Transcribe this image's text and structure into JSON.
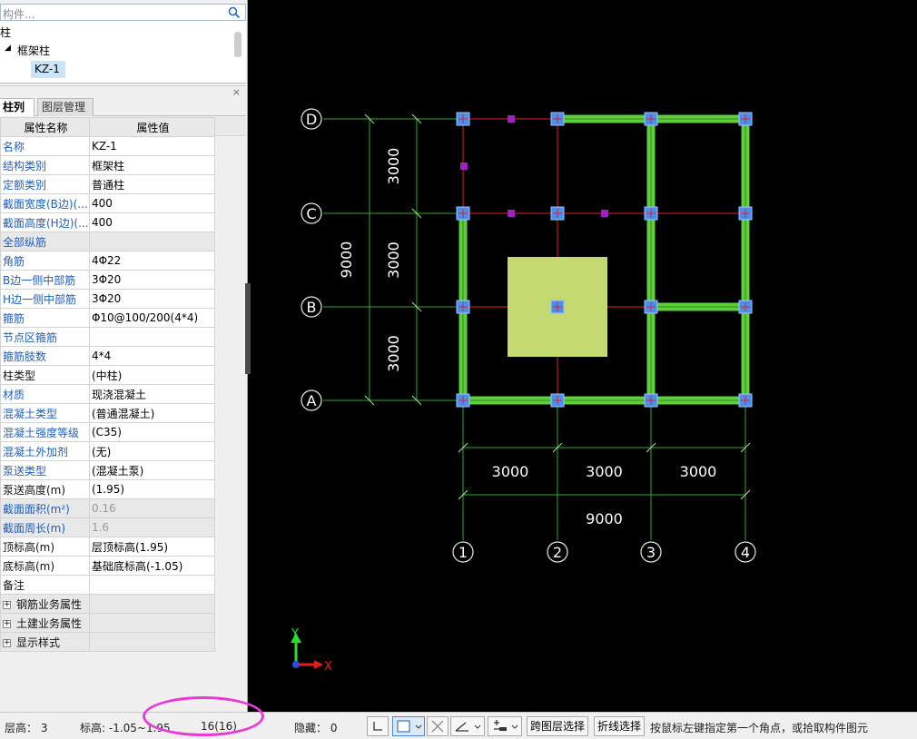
{
  "search": {
    "placeholder": "构件..."
  },
  "tree": {
    "root_label": "柱",
    "category_label": "框架柱",
    "selected_item": "KZ-1"
  },
  "panel": {
    "close_glyph": "×"
  },
  "tabs": [
    {
      "label": "柱列表"
    },
    {
      "label": "图层管理"
    }
  ],
  "table": {
    "header_name": "属性名称",
    "header_value": "属性值",
    "rows": [
      {
        "name": "名称",
        "value": "KZ-1"
      },
      {
        "name": "结构类别",
        "value": "框架柱"
      },
      {
        "name": "定额类别",
        "value": "普通柱"
      },
      {
        "name": "截面宽度(B边)(...",
        "value": "400"
      },
      {
        "name": "截面高度(H边)(...",
        "value": "400"
      },
      {
        "name": "全部纵筋",
        "value": ""
      },
      {
        "name": "角筋",
        "value": "4Φ22"
      },
      {
        "name": "B边一侧中部筋",
        "value": "3Φ20"
      },
      {
        "name": "H边一侧中部筋",
        "value": "3Φ20"
      },
      {
        "name": "箍筋",
        "value": "Φ10@100/200(4*4)"
      },
      {
        "name": "节点区箍筋",
        "value": ""
      },
      {
        "name": "箍筋肢数",
        "value": "4*4"
      },
      {
        "name": "柱类型",
        "value": "(中柱)"
      },
      {
        "name": "材质",
        "value": "现浇混凝土"
      },
      {
        "name": "混凝土类型",
        "value": "(普通混凝土)"
      },
      {
        "name": "混凝土强度等级",
        "value": "(C35)"
      },
      {
        "name": "混凝土外加剂",
        "value": "(无)"
      },
      {
        "name": "泵送类型",
        "value": "(混凝土泵)"
      },
      {
        "name": "泵送高度(m)",
        "value": "(1.95)"
      },
      {
        "name": "截面面积(m²)",
        "value": "0.16"
      },
      {
        "name": "截面周长(m)",
        "value": "1.6"
      },
      {
        "name": "顶标高(m)",
        "value": "层顶标高(1.95)"
      },
      {
        "name": "底标高(m)",
        "value": "基础底标高(-1.05)"
      },
      {
        "name": "备注",
        "value": ""
      }
    ],
    "groups": [
      {
        "label": "钢筋业务属性"
      },
      {
        "label": "土建业务属性"
      },
      {
        "label": "显示样式"
      }
    ]
  },
  "drawing": {
    "axis_rows": [
      "D",
      "C",
      "B",
      "A"
    ],
    "axis_cols": [
      "1",
      "2",
      "3",
      "4"
    ],
    "row_dims": [
      "3000",
      "3000",
      "3000"
    ],
    "row_total": "9000",
    "col_dims": [
      "3000",
      "3000",
      "3000"
    ],
    "col_total": "9000",
    "ucs_x": "X",
    "ucs_y": "Y",
    "colors": {
      "wall": "#5ecf3a",
      "column": "#4a8ff0",
      "axis": "#2fa82f",
      "grid_red": "#e02020",
      "slab": "#c4d96f",
      "marker": "#a020c0"
    }
  },
  "status": {
    "floor_height": "层高：  3",
    "elevation": "标高: -1.05~1.95",
    "count": "16(16)",
    "hidden": "隐藏：  0",
    "btn_cross_floor": "跨图层选择",
    "btn_polyline": "折线选择",
    "hint": "按鼠标左键指定第一个角点，或拾取构件图元",
    "ellipse_color": "#e93ad8"
  }
}
